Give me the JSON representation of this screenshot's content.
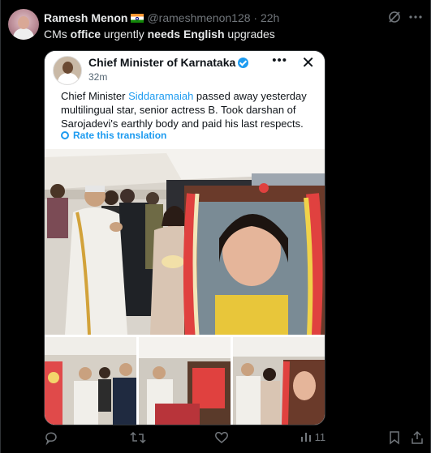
{
  "author": {
    "name": "Ramesh Menon",
    "flag_icon": "india-flag-icon",
    "handle": "@rameshmenon128",
    "separator": "·",
    "time": "22h"
  },
  "tweet": {
    "parts": [
      {
        "text": "CMs ",
        "bold": false
      },
      {
        "text": "office",
        "bold": true
      },
      {
        "text": " urgently ",
        "bold": false
      },
      {
        "text": "needs English",
        "bold": true
      },
      {
        "text": " upgrades",
        "bold": false
      }
    ]
  },
  "embed": {
    "name": "Chief Minister of Karnataka",
    "time": "32m",
    "more_label": "•••",
    "close_label": "✕",
    "text_before": "Chief Minister ",
    "text_link": "Siddaramaiah",
    "text_after": " passed away yesterday multilingual star, senior actress B. Took darshan of Sarojadevi's earthly body and paid his last respects.",
    "rate_label": "Rate this translation"
  },
  "actions": {
    "reply_icon": "reply-icon",
    "retweet_icon": "retweet-icon",
    "like_icon": "heart-icon",
    "views_icon": "views-icon",
    "views_count": "11",
    "bookmark_icon": "bookmark-icon",
    "share_icon": "share-icon"
  },
  "colors": {
    "accent": "#1d9bf0",
    "muted": "#71767b",
    "background": "#000000"
  }
}
